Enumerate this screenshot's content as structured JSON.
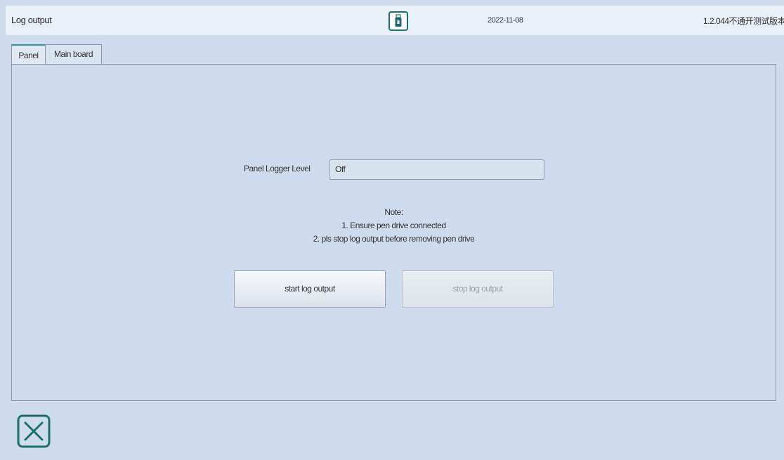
{
  "header": {
    "title": "Log output",
    "usb_icon": "usb-drive-icon",
    "date": "2022-11-08",
    "version": "1.2.044不通开测试版本"
  },
  "tabs": [
    {
      "label": "Panel",
      "active": true
    },
    {
      "label": "Main board",
      "active": false
    }
  ],
  "panel": {
    "logger_level_label": "Panel Logger Level",
    "logger_level_value": "Off",
    "note": {
      "heading": "Note:",
      "lines": [
        "1. Ensure pen drive connected",
        "2. pls stop log output before removing pen drive"
      ]
    },
    "start_button_label": "start log output",
    "stop_button_label": "stop log output",
    "stop_button_enabled": false
  },
  "footer": {
    "close_icon": "close-icon"
  },
  "colors": {
    "background": "#cfdced",
    "accent": "#1b6f6f",
    "border": "#8a98aa"
  }
}
